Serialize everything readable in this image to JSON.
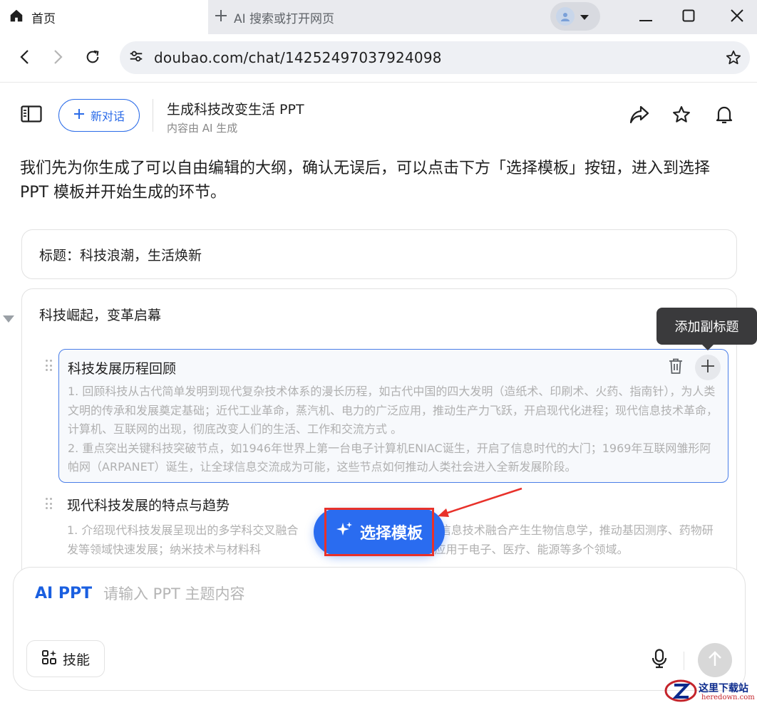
{
  "browser": {
    "active_tab": {
      "label": "首页",
      "icon": "home-icon"
    },
    "new_tab": {
      "label": "AI 搜索或打开网页",
      "icon": "plus-icon"
    },
    "url": "doubao.com/chat/14252497037924098"
  },
  "chat_header": {
    "new_chat_label": "新对话",
    "title": "生成科技改变生活 PPT",
    "subtitle": "内容由 AI 生成"
  },
  "intro_text": "我们先为你生成了可以自由编辑的大纲，确认无误后，可以点击下方「选择模板」按钮，进入到选择 PPT 模板并开始生成的环节。",
  "outline": {
    "title_card": "标题：科技浪潮，生活焕新",
    "section_title": "科技崛起，变革启幕",
    "tooltip": "添加副标题",
    "subsections": [
      {
        "title": "科技发展历程回顾",
        "point1": "1. 回顾科技从古代简单发明到现代复杂技术体系的漫长历程，如古代中国的四大发明（造纸术、印刷术、火药、指南针），为人类文明的传承和发展奠定基础；近代工业革命，蒸汽机、电力的广泛应用，推动生产力飞跃，开启现代化进程；现代信息技术革命，计算机、互联网的出现，彻底改变人们的生活、工作和交流方式 。",
        "point2": "2. 重点突出关键科技突破节点，如1946年世界上第一台电子计算机ENIAC诞生，开启了信息时代的大门；1969年互联网雏形阿帕网（ARPANET）诞生，让全球信息交流成为可能，这些节点如何推动人类社会进入全新发展阶段。"
      },
      {
        "title": "现代科技发展的特点与趋势",
        "point1": "1. 介绍现代科技发展呈现出的多学科交叉融合                                       信息技术融合产生生物信息学，推动基因测序、药物研发等领域快速发展；纳米技术与材料科                             能纳米材料，应用于电子、医疗、能源等多个领域。"
      }
    ]
  },
  "select_template_label": "选择模板",
  "composer": {
    "mode_label": "AI PPT",
    "placeholder": "请输入 PPT 主题内容",
    "skills_label": "技能"
  },
  "watermark": {
    "cn": "这里下载站",
    "en": "heredown.com"
  },
  "colors": {
    "accent": "#2a6cf0",
    "annotation": "#e8312a"
  }
}
